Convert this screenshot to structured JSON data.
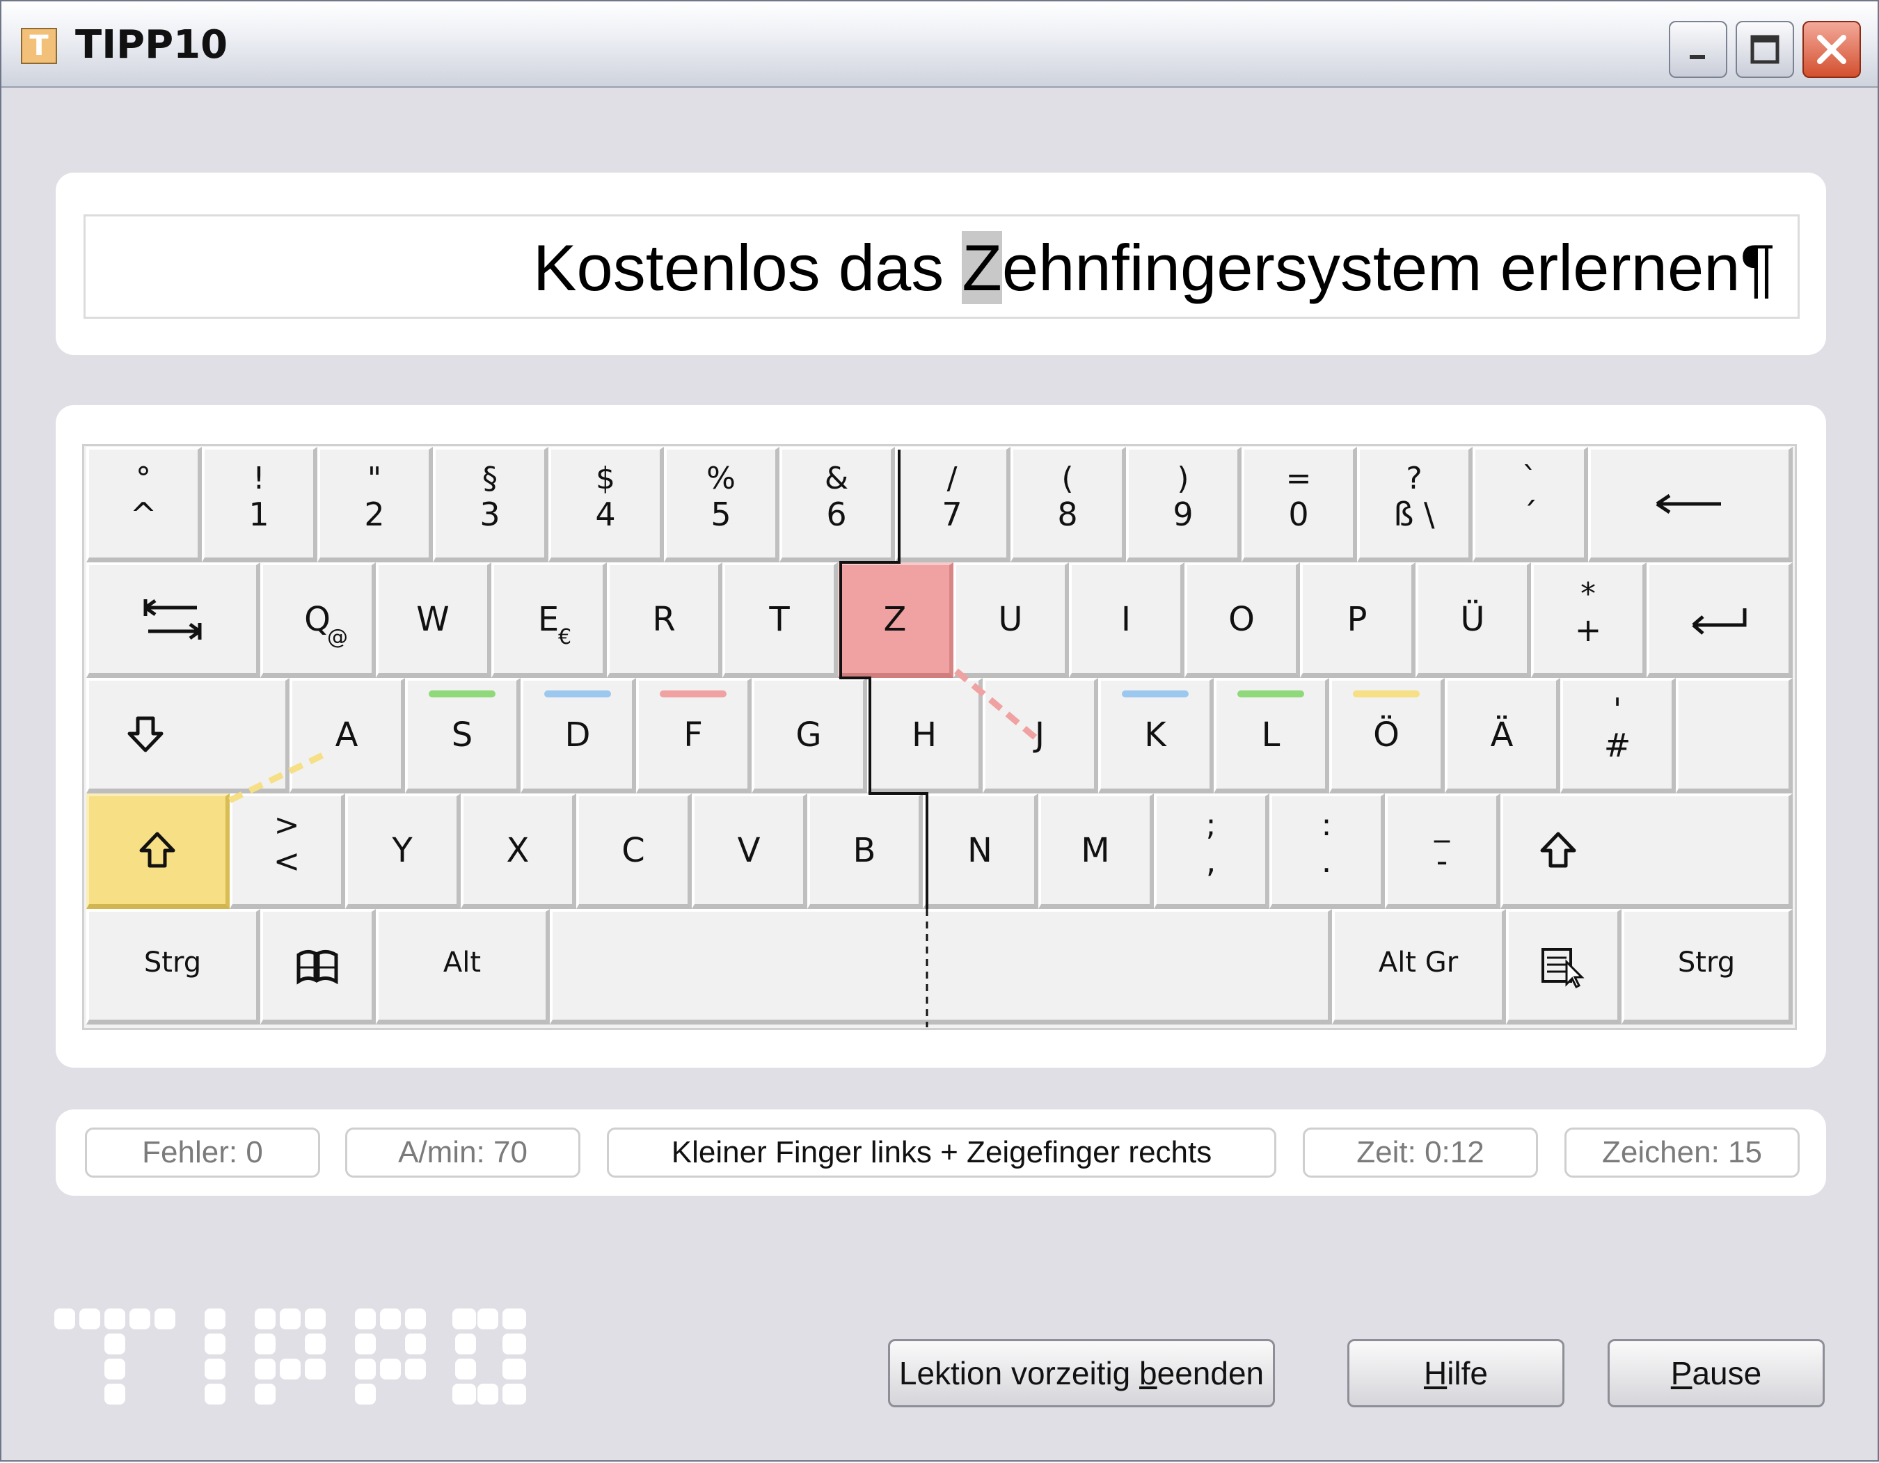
{
  "window": {
    "title": "TIPP10",
    "minimize": "minimize",
    "maximize": "maximize",
    "close": "close"
  },
  "lesson": {
    "before": "Kostenlos das ",
    "current": "Z",
    "after": "ehnfingersystem erlernen¶"
  },
  "keyboard": {
    "row1": [
      {
        "top": "°",
        "bot": "^"
      },
      {
        "top": "!",
        "bot": "1"
      },
      {
        "top": "\"",
        "bot": "2"
      },
      {
        "top": "§",
        "bot": "3"
      },
      {
        "top": "$",
        "bot": "4"
      },
      {
        "top": "%",
        "bot": "5"
      },
      {
        "top": "&",
        "bot": "6"
      },
      {
        "top": "/",
        "bot": "7"
      },
      {
        "top": "(",
        "bot": "8"
      },
      {
        "top": ")",
        "bot": "9"
      },
      {
        "top": "=",
        "bot": "0"
      },
      {
        "top": "?",
        "bot": "ß \\"
      },
      {
        "top": "`",
        "bot": "´"
      }
    ],
    "backspace_icon": "backspace-arrow-icon",
    "tab_icon": "tab-icon",
    "row2": [
      "Q",
      "W",
      "E",
      "R",
      "T",
      "Z",
      "U",
      "I",
      "O",
      "P",
      "Ü"
    ],
    "row2_sub": {
      "Q": "@",
      "E": "€"
    },
    "plus_key": {
      "top": "*",
      "bot": "+"
    },
    "enter_icon": "enter-icon",
    "capslock_icon": "capslock-arrow-icon",
    "row3": [
      "A",
      "S",
      "D",
      "F",
      "G",
      "H",
      "J",
      "K",
      "L",
      "Ö",
      "Ä"
    ],
    "hash_key": {
      "top": "'",
      "bot": "#"
    },
    "shift_icon": "shift-arrow-icon",
    "lt_key": {
      "top": ">",
      "bot": "<"
    },
    "row4": [
      "Y",
      "X",
      "C",
      "V",
      "B",
      "N",
      "M"
    ],
    "row4_punct": [
      {
        "top": ";",
        "bot": ","
      },
      {
        "top": ":",
        "bot": "."
      },
      {
        "top": "_",
        "bot": "-"
      }
    ],
    "row5": {
      "ctrl_left": "Strg",
      "win_icon": "windows-logo-icon",
      "alt": "Alt",
      "altgr": "Alt Gr",
      "menu_icon": "context-menu-icon",
      "ctrl_right": "Strg"
    },
    "highlight": {
      "target_key": "Z",
      "target_color": "#f0a2a2",
      "shift_color": "#f6df84"
    },
    "finger_colors": {
      "S": "#8fd97a",
      "D": "#9cc8ef",
      "F": "#f0a2a2",
      "K": "#9cc8ef",
      "L": "#8fd97a",
      "Ö": "#f6df84"
    }
  },
  "status": {
    "errors": "Fehler: 0",
    "speed": "A/min: 70",
    "hint": "Kleiner Finger links + Zeigefinger rechts",
    "time": "Zeit: 0:12",
    "chars": "Zeichen: 15"
  },
  "logo": "TIPP10",
  "buttons": {
    "end_lesson": {
      "pre": "Lektion vorzeitig ",
      "u": "b",
      "post": "eenden"
    },
    "help": {
      "pre": "",
      "u": "H",
      "post": "ilfe"
    },
    "pause": {
      "pre": "",
      "u": "P",
      "post": "ause"
    }
  }
}
